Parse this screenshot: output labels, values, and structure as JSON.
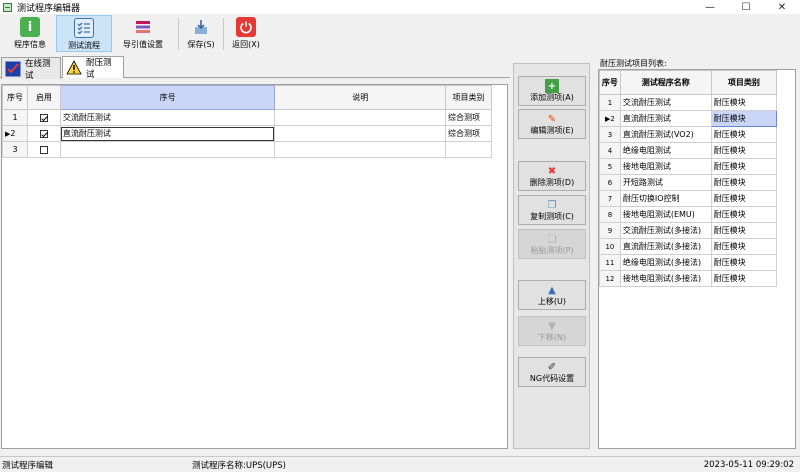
{
  "window": {
    "title": "测试程序编辑器",
    "controls": {
      "minimize": "—",
      "maximize": "☐",
      "close": "✕"
    }
  },
  "toolbar": {
    "items": [
      {
        "label": "程序信息",
        "icon": "info-icon",
        "color": "#4caf50"
      },
      {
        "label": "测试流程",
        "icon": "checklist-icon",
        "color": "#3f6fb5"
      },
      {
        "label": "导引值设置",
        "icon": "settings-grid-icon",
        "color": "#c2185b"
      },
      {
        "label": "保存(S)",
        "icon": "save-icon",
        "color": "#5a8fc9"
      },
      {
        "label": "返回(X)",
        "icon": "power-icon",
        "color": "#e53935"
      }
    ]
  },
  "tabs": [
    {
      "label": "在线测试",
      "icon": "check-mark-icon"
    },
    {
      "label": "耐压测试",
      "icon": "warning-icon"
    }
  ],
  "main_grid": {
    "headers": [
      "序号",
      "启用",
      "序号",
      "说明",
      "项目类别"
    ],
    "rows": [
      {
        "num": "1",
        "enabled": true,
        "name": "交流耐压测试",
        "desc": "",
        "category": "综合测项"
      },
      {
        "num": "2",
        "enabled": true,
        "name": "直流耐压测试",
        "desc": "",
        "category": "综合测项"
      },
      {
        "num": "3",
        "enabled": false,
        "name": "",
        "desc": "",
        "category": ""
      }
    ]
  },
  "side_buttons": [
    {
      "label": "添加测项(A)",
      "icon": "plus-icon",
      "enabled": true
    },
    {
      "label": "编辑测项(E)",
      "icon": "edit-icon",
      "enabled": true
    },
    {
      "label": "删除测项(D)",
      "icon": "delete-icon",
      "enabled": true
    },
    {
      "label": "复制测项(C)",
      "icon": "copy-icon",
      "enabled": true
    },
    {
      "label": "粘贴测项(P)",
      "icon": "paste-icon",
      "enabled": false
    },
    {
      "label": "上移(U)",
      "icon": "arrow-up-icon",
      "enabled": true
    },
    {
      "label": "下移(N)",
      "icon": "arrow-down-icon",
      "enabled": false
    },
    {
      "label": "NG代码设置",
      "icon": "pencil-icon",
      "enabled": true
    }
  ],
  "right_list": {
    "label": "耐压测试项目列表:",
    "headers": [
      "序号",
      "测试程序名称",
      "项目类别"
    ],
    "rows": [
      {
        "num": "1",
        "name": "交流耐压测试",
        "category": "耐压模块"
      },
      {
        "num": "2",
        "name": "直流耐压测试",
        "category": "耐压模块"
      },
      {
        "num": "3",
        "name": "直流耐压测试(VO2)",
        "category": "耐压模块"
      },
      {
        "num": "4",
        "name": "绝缘电阻测试",
        "category": "耐压模块"
      },
      {
        "num": "5",
        "name": "接地电阻测试",
        "category": "耐压模块"
      },
      {
        "num": "6",
        "name": "开短路测试",
        "category": "耐压模块"
      },
      {
        "num": "7",
        "name": "耐压切换IO控制",
        "category": "耐压模块"
      },
      {
        "num": "8",
        "name": "接地电阻测试(EMU)",
        "category": "耐压模块"
      },
      {
        "num": "9",
        "name": "交流耐压测试(多接法)",
        "category": "耐压模块"
      },
      {
        "num": "10",
        "name": "直流耐压测试(多接法)",
        "category": "耐压模块"
      },
      {
        "num": "11",
        "name": "绝缘电阻测试(多接法)",
        "category": "耐压模块"
      },
      {
        "num": "12",
        "name": "接地电阻测试(多接法)",
        "category": "耐压模块"
      }
    ]
  },
  "status": {
    "left": "测试程序编辑",
    "program": "测试程序名称:UPS(UPS)",
    "datetime": "2023-05-11  09:29:02"
  }
}
